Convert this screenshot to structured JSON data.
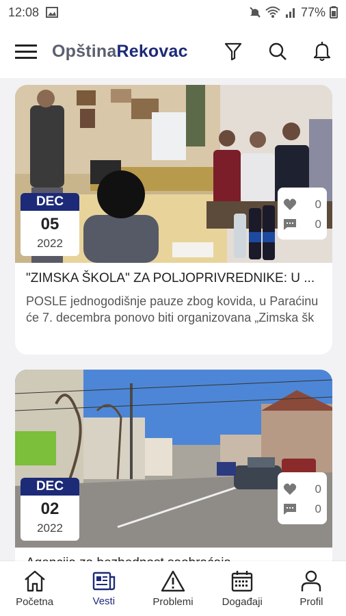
{
  "status_bar": {
    "time": "12:08",
    "battery": "77%"
  },
  "header": {
    "brand_left": "Opština",
    "brand_right": "Rekovac"
  },
  "articles": [
    {
      "month": "DEC",
      "day": "05",
      "year": "2022",
      "likes": "0",
      "comments": "0",
      "title": "\"ZIMSKA ŠKOLA\" ZA POLJOPRIVREDNIKE: U ...",
      "excerpt": "POSLE jednogodišnje pauze zbog kovida, u Paraćinu će 7. decembra ponovo biti organizovana „Zimska šk"
    },
    {
      "month": "DEC",
      "day": "02",
      "year": "2022",
      "likes": "0",
      "comments": "0",
      "title": "Agencija za bezbednost saobraćaja"
    }
  ],
  "bottom_nav": [
    {
      "label": "Početna",
      "icon": "home-icon"
    },
    {
      "label": "Vesti",
      "icon": "news-icon"
    },
    {
      "label": "Problemi",
      "icon": "warning-icon"
    },
    {
      "label": "Događaji",
      "icon": "calendar-icon"
    },
    {
      "label": "Profil",
      "icon": "person-icon"
    }
  ],
  "colors": {
    "accent": "#1d2a78",
    "brand_grey": "#5b6070"
  }
}
